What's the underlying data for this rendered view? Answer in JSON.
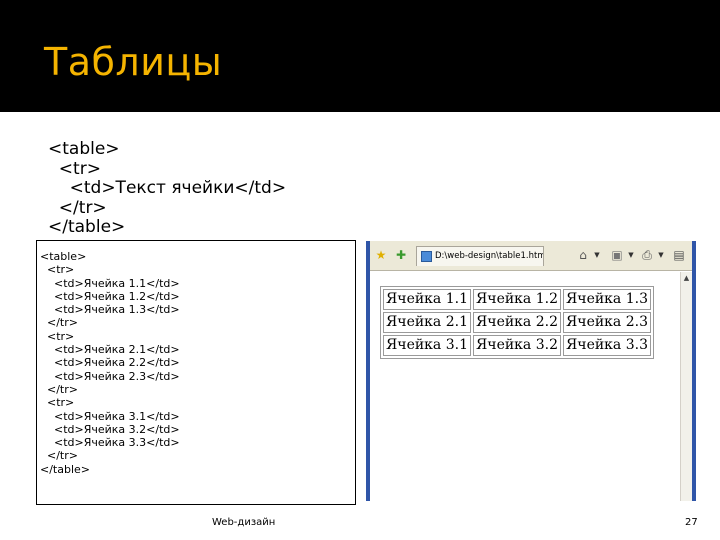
{
  "slide": {
    "title": "Таблицы",
    "footer": "Web-дизайн",
    "page_number": "27",
    "colors": {
      "title_bar": "#000000",
      "title_text": "#f5b400",
      "browser_frame": "#2f55a8"
    }
  },
  "code_example": [
    "<table>",
    "  <tr>",
    "    <td>Текст ячейки</td>",
    "  </tr>",
    "</table>"
  ],
  "source_listing": [
    "<table>",
    "  <tr>",
    "    <td>Ячейка 1.1</td>",
    "    <td>Ячейка 1.2</td>",
    "    <td>Ячейка 1.3</td>",
    "  </tr>",
    "  <tr>",
    "    <td>Ячейка 2.1</td>",
    "    <td>Ячейка 2.2</td>",
    "    <td>Ячейка 2.3</td>",
    "  </tr>",
    "  <tr>",
    "    <td>Ячейка 3.1</td>",
    "    <td>Ячейка 3.2</td>",
    "    <td>Ячейка 3.3</td>",
    "  </tr>",
    "</table>"
  ],
  "browser": {
    "tab_title": "D:\\web-design\\table1.htm",
    "icons": [
      "favorites-star-icon",
      "add-favorites-icon",
      "page-icon",
      "home-icon",
      "feeds-icon",
      "print-icon",
      "page-menu-icon"
    ],
    "table": [
      [
        "Ячейка 1.1",
        "Ячейка 1.2",
        "Ячейка 1.3"
      ],
      [
        "Ячейка 2.1",
        "Ячейка 2.2",
        "Ячейка 2.3"
      ],
      [
        "Ячейка 3.1",
        "Ячейка 3.2",
        "Ячейка 3.3"
      ]
    ]
  }
}
